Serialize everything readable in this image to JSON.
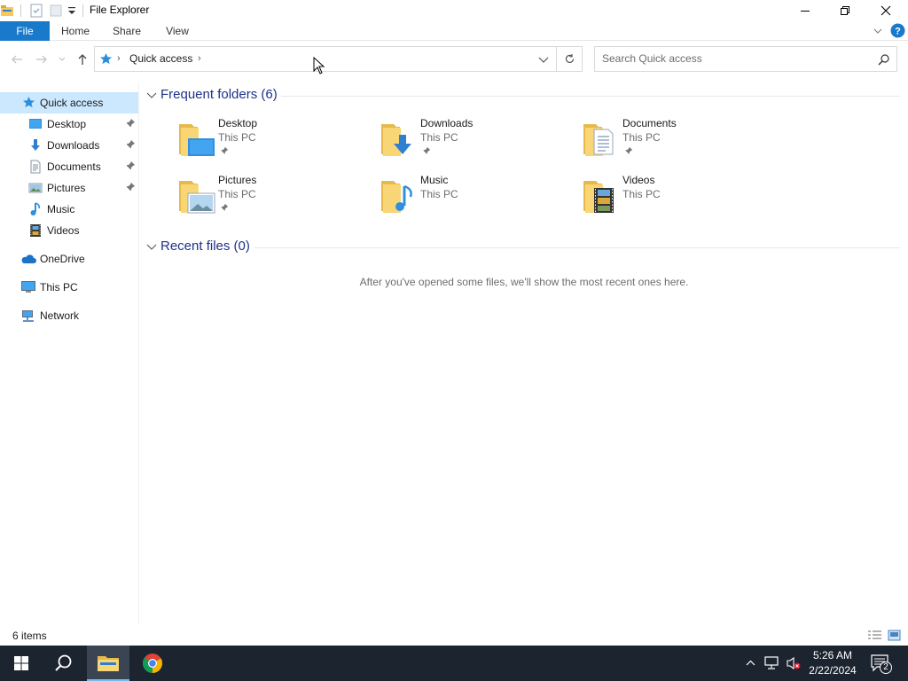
{
  "window": {
    "title": "File Explorer"
  },
  "ribbon": {
    "tabs": [
      {
        "label": "File"
      },
      {
        "label": "Home"
      },
      {
        "label": "Share"
      },
      {
        "label": "View"
      }
    ]
  },
  "address": {
    "crumb": "Quick access"
  },
  "search": {
    "placeholder": "Search Quick access"
  },
  "sidebar": {
    "items": [
      {
        "label": "Quick access",
        "icon": "star-icon",
        "selected": true
      },
      {
        "label": "Desktop",
        "icon": "desktop-folder-icon",
        "pinned": true
      },
      {
        "label": "Downloads",
        "icon": "download-arrow-icon",
        "pinned": true
      },
      {
        "label": "Documents",
        "icon": "document-icon",
        "pinned": true
      },
      {
        "label": "Pictures",
        "icon": "picture-icon",
        "pinned": true
      },
      {
        "label": "Music",
        "icon": "music-note-icon"
      },
      {
        "label": "Videos",
        "icon": "film-icon"
      },
      {
        "label": "OneDrive",
        "icon": "cloud-icon"
      },
      {
        "label": "This PC",
        "icon": "computer-icon"
      },
      {
        "label": "Network",
        "icon": "network-icon"
      }
    ]
  },
  "frequent": {
    "title": "Frequent folders (6)",
    "folders": [
      {
        "name": "Desktop",
        "location": "This PC",
        "pinned": true
      },
      {
        "name": "Downloads",
        "location": "This PC",
        "pinned": true
      },
      {
        "name": "Documents",
        "location": "This PC",
        "pinned": true
      },
      {
        "name": "Pictures",
        "location": "This PC",
        "pinned": true
      },
      {
        "name": "Music",
        "location": "This PC",
        "pinned": false
      },
      {
        "name": "Videos",
        "location": "This PC",
        "pinned": false
      }
    ]
  },
  "recent": {
    "title": "Recent files (0)",
    "empty_message": "After you've opened some files, we'll show the most recent ones here."
  },
  "status": {
    "item_count": "6 items"
  },
  "taskbar": {
    "time": "5:26 AM",
    "date": "2/22/2024",
    "notification_count": "2"
  },
  "colors": {
    "accent": "#1979ca",
    "group_title": "#1e3287",
    "selected_bg": "#cce8ff",
    "taskbar_bg": "#1c2430",
    "folder_yellow": "#f5c95b"
  }
}
